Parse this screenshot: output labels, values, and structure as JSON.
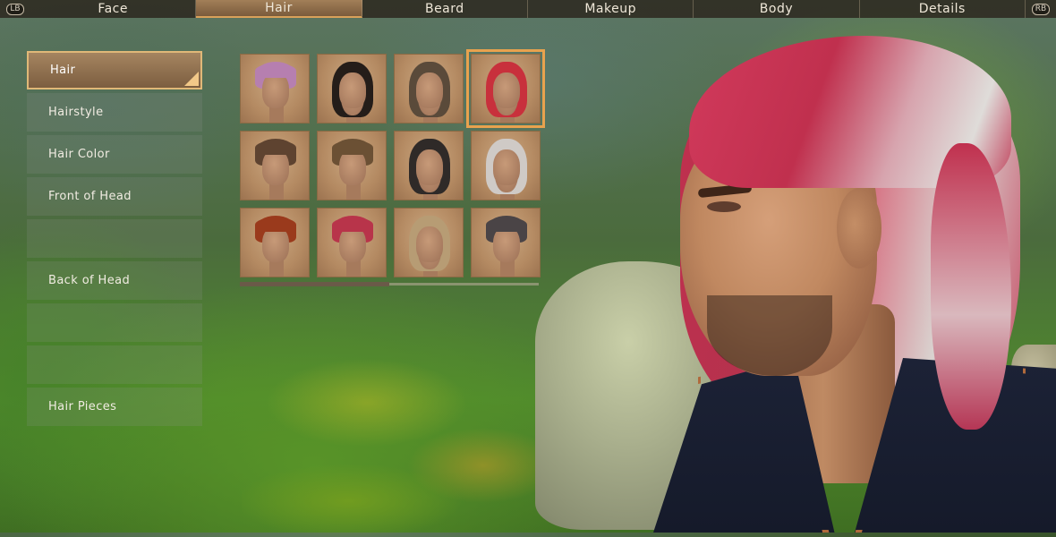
{
  "tabs": {
    "left_bumper": "LB",
    "right_bumper": "RB",
    "items": [
      "Face",
      "Hair",
      "Beard",
      "Makeup",
      "Body",
      "Details"
    ],
    "active": "Hair"
  },
  "menu": {
    "items": [
      {
        "label": "Hair",
        "state": "active"
      },
      {
        "label": "Hairstyle",
        "state": "normal"
      },
      {
        "label": "Hair Color",
        "state": "normal"
      },
      {
        "label": "Front of Head",
        "state": "normal"
      },
      {
        "label": "",
        "state": "faded"
      },
      {
        "label": "Back of Head",
        "state": "normal"
      },
      {
        "label": "",
        "state": "faded"
      },
      {
        "label": "",
        "state": "faded"
      },
      {
        "label": "Hair Pieces",
        "state": "normal"
      }
    ]
  },
  "grid": {
    "selected_index": 3,
    "styles": [
      {
        "color": "#b67fb0",
        "shape": "short"
      },
      {
        "color": "#241d19",
        "shape": "long"
      },
      {
        "color": "#5a4a3a",
        "shape": "long"
      },
      {
        "color": "#c8303c",
        "shape": "long"
      },
      {
        "color": "#5e4330",
        "shape": "short"
      },
      {
        "color": "#6b5034",
        "shape": "short"
      },
      {
        "color": "#2f2a28",
        "shape": "long"
      },
      {
        "color": "#cfcac6",
        "shape": "long"
      },
      {
        "color": "#9a3a1c",
        "shape": "short"
      },
      {
        "color": "#b8344a",
        "shape": "short"
      },
      {
        "color": "#b79c74",
        "shape": "long"
      },
      {
        "color": "#4a4446",
        "shape": "short"
      }
    ]
  },
  "scroll": {
    "position_fraction": 0.5
  }
}
